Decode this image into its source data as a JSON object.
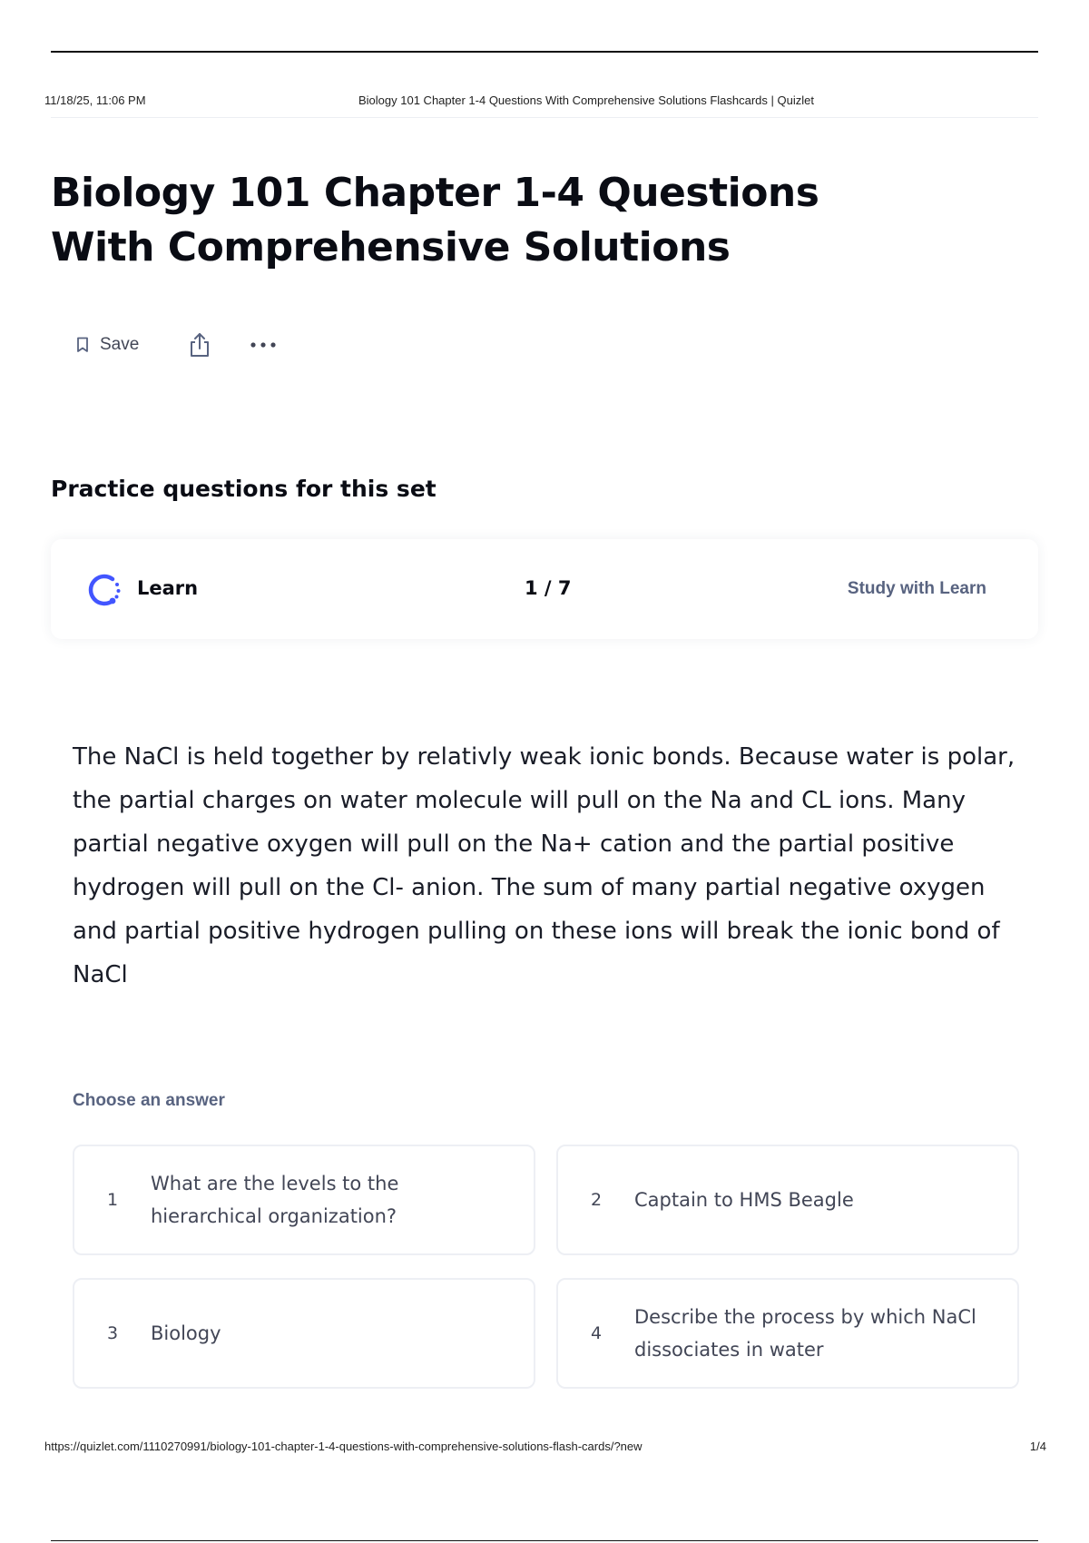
{
  "print_header": {
    "datetime": "11/18/25, 11:06 PM",
    "doc_title": "Biology 101 Chapter 1-4 Questions With Comprehensive Solutions Flashcards | Quizlet"
  },
  "set": {
    "title": "Biology 101 Chapter 1-4 Questions With Comprehensive Solutions"
  },
  "actions": {
    "save_label": "Save",
    "icons": [
      "bookmark-icon",
      "share-icon",
      "more-icon"
    ]
  },
  "practice": {
    "heading": "Practice questions for this set",
    "mode_label": "Learn",
    "progress": "1 / 7",
    "study_link": "Study with Learn",
    "accent_color": "#4255ff"
  },
  "question": {
    "definition": "The NaCl is held together by relativly weak ionic bonds. Because water is polar, the partial charges on water molecule will pull on the Na and CL ions. Many partial negative oxygen will pull on the Na+ cation and the partial positive hydrogen will pull on the Cl- anion. The sum of many partial negative oxygen and partial positive hydrogen pulling on these ions will break the ionic bond of NaCl",
    "choose_label": "Choose an answer",
    "answers": [
      {
        "num": "1",
        "text": "What are the levels to the hierarchical organization?"
      },
      {
        "num": "2",
        "text": "Captain to HMS Beagle"
      },
      {
        "num": "3",
        "text": "Biology"
      },
      {
        "num": "4",
        "text": "Describe the process by which NaCl dissociates in water"
      }
    ]
  },
  "print_footer": {
    "url": "https://quizlet.com/1110270991/biology-101-chapter-1-4-questions-with-comprehensive-solutions-flash-cards/?new",
    "page": "1/4"
  }
}
